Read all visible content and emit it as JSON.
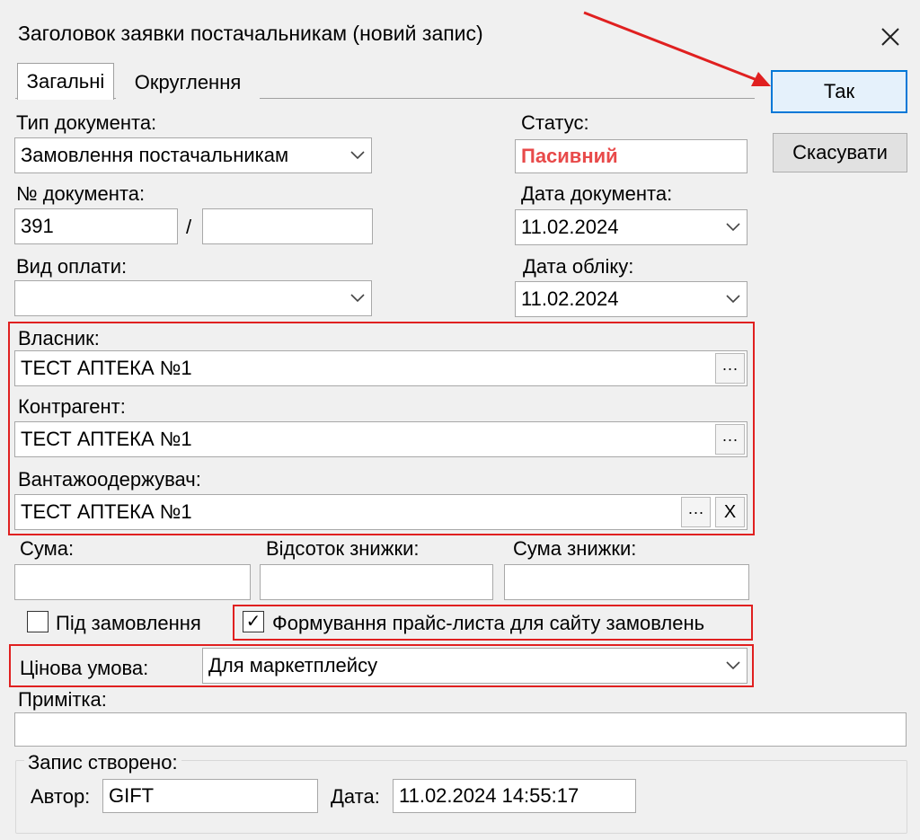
{
  "window": {
    "title": "Заголовок заявки постачальникам (новий запис)"
  },
  "tabs": [
    {
      "label": "Загальні"
    },
    {
      "label": "Округлення"
    }
  ],
  "buttons": {
    "ok": "Так",
    "cancel": "Скасувати"
  },
  "doc_type": {
    "label": "Тип документа:",
    "value": "Замовлення постачальникам"
  },
  "status": {
    "label": "Статус:",
    "value": "Пасивний",
    "color": "#e84a4a"
  },
  "doc_number": {
    "label": "№ документа:",
    "value": "391",
    "separator": "/",
    "suffix": ""
  },
  "doc_date": {
    "label": "Дата документа:",
    "value": "11.02.2024"
  },
  "payment_type": {
    "label": "Вид оплати:",
    "value": ""
  },
  "account_date": {
    "label": "Дата обліку:",
    "value": "11.02.2024"
  },
  "owner": {
    "label": "Власник:",
    "value": "ТЕСТ АПТЕКА №1",
    "browse": "···"
  },
  "counterparty": {
    "label": "Контрагент:",
    "value": "ТЕСТ АПТЕКА №1",
    "browse": "···"
  },
  "consignee": {
    "label": "Вантажоодержувач:",
    "value": "ТЕСТ АПТЕКА №1",
    "browse": "···",
    "clear": "X"
  },
  "sum": {
    "label": "Сума:",
    "value": ""
  },
  "discount_percent": {
    "label": "Відсоток знижки:",
    "value": ""
  },
  "discount_sum": {
    "label": "Сума знижки:",
    "value": ""
  },
  "under_order": {
    "label": "Під замовлення",
    "checked": false
  },
  "price_list": {
    "label": "Формування прайс-листа для сайту замовлень",
    "checked": true,
    "mark": "✓"
  },
  "price_condition": {
    "label": "Цінова умова:",
    "value": "Для маркетплейсу"
  },
  "note": {
    "label": "Примітка:",
    "value": ""
  },
  "record": {
    "group_label": "Запис створено:",
    "author_label": "Автор:",
    "author": "GIFT",
    "date_label": "Дата:",
    "date": "11.02.2024 14:55:17"
  },
  "colors": {
    "highlight": "#e02020",
    "accent": "#0078d7"
  }
}
